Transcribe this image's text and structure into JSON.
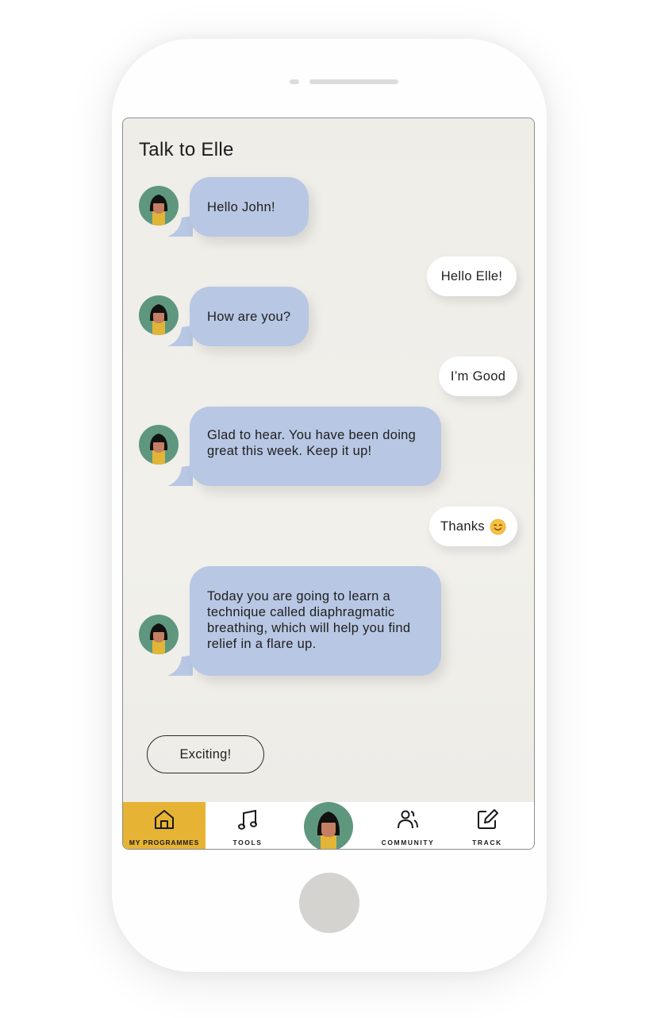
{
  "screen": {
    "title": "Talk to Elle"
  },
  "conversation": [
    {
      "from": "elle",
      "text": "Hello John!"
    },
    {
      "from": "user",
      "text": "Hello Elle!"
    },
    {
      "from": "elle",
      "text": "How are you?"
    },
    {
      "from": "user",
      "text": "I’m Good"
    },
    {
      "from": "elle",
      "text": "Glad to hear. You have been doing\ngreat this week. Keep it up!"
    },
    {
      "from": "user",
      "text": "Thanks",
      "emoji": "smiling-face-emoji"
    },
    {
      "from": "elle",
      "text": "Today you are going to learn a\ntechnique called diaphragmatic\nbreathing, which will help you find\nrelief in a flare up."
    }
  ],
  "quick_reply": {
    "label": "Exciting!"
  },
  "tabbar": {
    "tabs": [
      {
        "label": "MY PROGRAMMES",
        "icon": "home-icon",
        "active": true
      },
      {
        "label": "TOOLS",
        "icon": "music-note-icon",
        "active": false
      },
      {
        "label": "",
        "icon": "elle-avatar",
        "active": false
      },
      {
        "label": "COMMUNITY",
        "icon": "people-icon",
        "active": false
      },
      {
        "label": "TRACK",
        "icon": "edit-icon",
        "active": false
      }
    ]
  },
  "colors": {
    "elle_bubble": "#b8c7e3",
    "user_bubble": "#ffffff",
    "avatar_bg": "#5e977e",
    "active_tab": "#e6b334",
    "screen_bg": "#efede8"
  }
}
